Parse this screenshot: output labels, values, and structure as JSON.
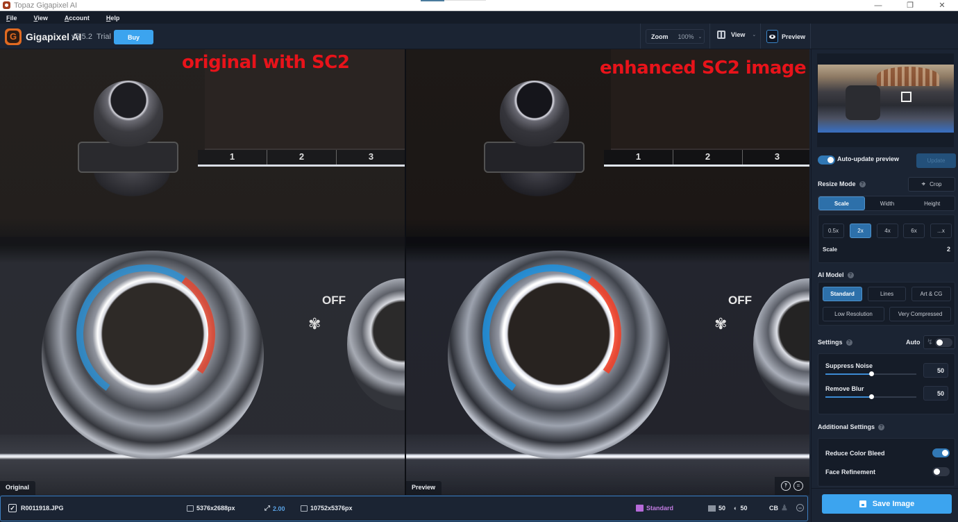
{
  "window": {
    "title": "Topaz Gigapixel AI",
    "controls": [
      "minimize",
      "restore",
      "close"
    ]
  },
  "menu": [
    "File",
    "View",
    "Account",
    "Help"
  ],
  "toolbar": {
    "brand": "Gigapixel AI",
    "version": "v5.5.2",
    "license": "Trial",
    "buy_label": "Buy",
    "zoom_label": "Zoom",
    "zoom_value": "100%",
    "view_label": "View",
    "preview_label": "Preview"
  },
  "canvas": {
    "left_overlay": "original with SC2",
    "right_overlay": "enhanced SC2 image",
    "left_label": "Original",
    "right_label": "Preview",
    "preset_buttons": [
      "1",
      "2",
      "3"
    ],
    "off_text": "OFF"
  },
  "filebar": {
    "checked": true,
    "filename": "R0011918.JPG",
    "input_dims": "5376x2688px",
    "scale": "2.00",
    "output_dims": "10752x5376px",
    "model": "Standard",
    "noise": "50",
    "blur": "50",
    "cb": "CB"
  },
  "sidebar": {
    "auto_update_label": "Auto-update preview",
    "auto_update_on": true,
    "update_label": "Update",
    "resize_mode": {
      "title": "Resize Mode",
      "crop_label": "Crop",
      "modes": [
        "Scale",
        "Width",
        "Height"
      ],
      "active_mode": "Scale",
      "presets": [
        "0.5x",
        "2x",
        "4x",
        "6x",
        "...x"
      ],
      "active_preset": "2x",
      "scale_label": "Scale",
      "scale_value": "2"
    },
    "ai_model": {
      "title": "AI Model",
      "models": [
        "Standard",
        "Lines",
        "Art & CG",
        "Low Resolution",
        "Very Compressed"
      ],
      "active": "Standard"
    },
    "settings": {
      "title": "Settings",
      "auto_label": "Auto",
      "auto_on": false,
      "suppress_noise_label": "Suppress Noise",
      "suppress_noise_value": "50",
      "suppress_noise_pct": 50,
      "remove_blur_label": "Remove Blur",
      "remove_blur_value": "50",
      "remove_blur_pct": 50
    },
    "additional": {
      "title": "Additional Settings",
      "reduce_color_bleed_label": "Reduce Color Bleed",
      "reduce_color_bleed_on": true,
      "face_refinement_label": "Face Refinement",
      "face_refinement_on": false
    },
    "save_label": "Save Image"
  },
  "colors": {
    "accent": "#3ca4ef",
    "active": "#2d70aa",
    "overlay_text": "#e8131a",
    "model_tag": "#c07be0"
  }
}
